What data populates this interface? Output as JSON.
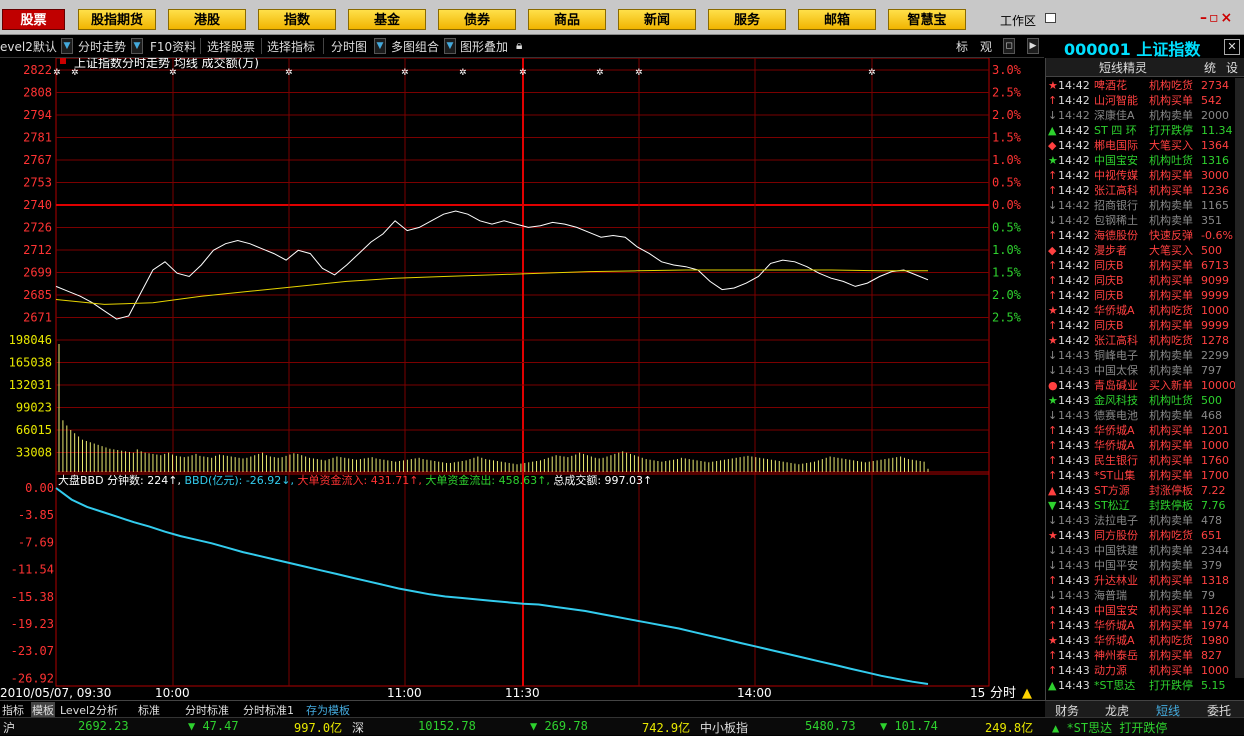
{
  "menu": [
    "股票",
    "股指期货",
    "港股",
    "指数",
    "基金",
    "债券",
    "商品",
    "新闻",
    "服务",
    "邮箱",
    "智慧宝"
  ],
  "workarea": "工作区",
  "toolbar": {
    "level2": "evel2默认",
    "items": [
      "分时走势",
      "F10资料",
      "选择股票",
      "选择指标",
      "分时图",
      "多图组合",
      "图形叠加"
    ],
    "right_icons": [
      "标",
      "观"
    ]
  },
  "index_header": {
    "code": "000001",
    "name": "上证指数"
  },
  "chart_data": [
    {
      "type": "line",
      "title": "上证指数分时走势 均线 成交额(万)",
      "y_ticks": [
        2822,
        2808,
        2794,
        2781,
        2767,
        2753,
        2740,
        2726,
        2712,
        2699,
        2685,
        2671
      ],
      "y_range": [
        2665,
        2825
      ],
      "right_ticks": [
        "3.0%",
        "2.5%",
        "2.0%",
        "1.5%",
        "1.0%",
        "0.5%",
        "0.0%",
        "0.5%",
        "1.0%",
        "1.5%",
        "2.0%",
        "2.5%"
      ],
      "x_labels": [
        "2010/05/07, 09:30",
        "10:00",
        "11:00",
        "11:30",
        "14:00",
        "15:00"
      ],
      "series": [
        {
          "name": "分时走势",
          "color": "#ffffff",
          "values": [
            2690,
            2687,
            2684,
            2680,
            2675,
            2670,
            2672,
            2686,
            2700,
            2705,
            2698,
            2696,
            2703,
            2712,
            2716,
            2718,
            2716,
            2713,
            2710,
            2706,
            2712,
            2710,
            2701,
            2697,
            2703,
            2710,
            2717,
            2722,
            2730,
            2724,
            2726,
            2730,
            2734,
            2736,
            2734,
            2730,
            2728,
            2730,
            2728,
            2726,
            2727,
            2729,
            2728,
            2726,
            2723,
            2720,
            2721,
            2720,
            2714,
            2710,
            2705,
            2703,
            2702,
            2700,
            2693,
            2688,
            2689,
            2692,
            2696,
            2704,
            2706,
            2705,
            2702,
            2698,
            2695,
            2693,
            2690,
            2692,
            2696,
            2699,
            2700,
            2697,
            2694
          ],
          "t": [
            0,
            2,
            4,
            7,
            10,
            15,
            20,
            25,
            28,
            32,
            36,
            40,
            45,
            50,
            55,
            60,
            66,
            72,
            78,
            82,
            86,
            90,
            95,
            100,
            106,
            110,
            116,
            120,
            126,
            130,
            134,
            140,
            145,
            150,
            154,
            158,
            162,
            166,
            170,
            174,
            178,
            182,
            186,
            190,
            194,
            198,
            202,
            206,
            210,
            214,
            218,
            222,
            226,
            230,
            234,
            238,
            242,
            246,
            250,
            254,
            258,
            262,
            166.1,
            170.1,
            174.1,
            178.1,
            182.1,
            186.1,
            190.1,
            194.1,
            198.1,
            202.1,
            206.1
          ]
        },
        {
          "name": "均线",
          "color": "#e6d300",
          "values": [
            2682,
            2679,
            2680,
            2684,
            2687,
            2690,
            2693,
            2695,
            2696,
            2697,
            2698,
            2699,
            2699.5,
            2700,
            2700,
            2700,
            2700,
            2699.5,
            2699.5
          ]
        }
      ]
    },
    {
      "type": "bar",
      "title": "成交额(万)",
      "y_ticks": [
        198046,
        165038,
        132031,
        99023,
        66015,
        33008
      ],
      "y_max": 198046,
      "values": [
        198000,
        80000,
        72000,
        65000,
        60000,
        55000,
        50000,
        48000,
        46000,
        44000,
        42000,
        40000,
        38000,
        36000,
        35000,
        34000,
        33000,
        32000,
        31000,
        30000,
        35000,
        32000,
        30000,
        29000,
        28000,
        27000,
        26000,
        28000,
        30000,
        27000,
        25000,
        24000,
        23000,
        24000,
        26000,
        28000,
        25000,
        24000,
        23000,
        22000,
        25000,
        27000,
        26000,
        25000,
        24000,
        23000,
        22000,
        21000,
        22000,
        24000,
        26000,
        28000,
        30000,
        26000,
        24000,
        23000,
        22000,
        23000,
        25000,
        27000,
        29000,
        28000,
        26000,
        24000,
        22000,
        21000,
        20000,
        19000,
        18000,
        20000,
        22000,
        24000,
        23000,
        22000,
        21000,
        20000,
        19000,
        20000,
        21000,
        22000,
        23000,
        21000,
        20000,
        19000,
        18000,
        17000,
        16000,
        17000,
        18000,
        19000,
        20000,
        21000,
        22000,
        20000,
        19000,
        18000,
        17000,
        16000,
        15000,
        14000,
        14000,
        15000,
        16000,
        17000,
        18000,
        20000,
        22000,
        24000,
        22000,
        20000,
        19000,
        18000,
        17000,
        16000,
        15000,
        14000,
        13000,
        12000,
        13000,
        14000,
        15000,
        16000,
        17000,
        18000,
        20000,
        22000,
        24000,
        26000,
        25000,
        24000,
        23000,
        25000,
        27000,
        30000,
        28000,
        26000,
        24000,
        22000,
        21000,
        22000,
        24000,
        26000,
        28000,
        30000,
        32000,
        30000,
        28000,
        26000,
        24000,
        22000,
        20000,
        19000,
        18000,
        17000,
        16000,
        17000,
        18000,
        19000,
        20000,
        22000,
        21000,
        20000,
        19000,
        18000,
        17000,
        16000,
        15000,
        16000,
        17000,
        18000,
        19000,
        20000,
        21000,
        22000,
        23000,
        24000,
        25000,
        24000,
        23000,
        22000,
        21000,
        20000,
        19000,
        18000,
        17000,
        16000,
        15000,
        14000,
        13000,
        12000,
        13000,
        14000,
        15000,
        16000,
        18000,
        20000,
        22000,
        24000,
        23000,
        22000,
        21000,
        20000,
        19000,
        18000,
        17000,
        16000,
        15000,
        16000,
        17000,
        18000,
        19000,
        20000,
        21000,
        22000,
        23000,
        24000,
        22000,
        20000,
        19000,
        18000,
        17000,
        16000,
        5000
      ]
    },
    {
      "type": "line",
      "title": "大盘BBD",
      "y_ticks": [
        "0.00",
        "-3.85",
        "-7.69",
        "-11.54",
        "-15.38",
        "-19.23",
        "-23.07",
        "-26.92"
      ],
      "y_range": [
        -26.92,
        0
      ],
      "series": [
        {
          "name": "BBD(亿元)",
          "color": "#33ccee",
          "values": [
            0,
            -1.6,
            -2.6,
            -3.3,
            -4.0,
            -4.7,
            -5.3,
            -6.0,
            -6.6,
            -7.1,
            -7.6,
            -8.2,
            -8.8,
            -9.3,
            -9.8,
            -10.3,
            -10.8,
            -11.3,
            -11.8,
            -12.3,
            -12.8,
            -13.3,
            -13.8,
            -14.2,
            -14.6,
            -14.9,
            -15.1,
            -15.3,
            -15.5,
            -15.7,
            -15.9,
            -16.0,
            -16.3,
            -16.6,
            -16.9,
            -17.3,
            -17.7,
            -18.1,
            -18.5,
            -18.9,
            -19.3,
            -19.8,
            -20.3,
            -20.8,
            -21.3,
            -21.8,
            -22.3,
            -22.8,
            -23.3,
            -23.8,
            -24.3,
            -24.8,
            -25.3,
            -25.8,
            -26.2,
            -26.6,
            -26.92
          ]
        }
      ]
    }
  ],
  "bbd_legend": {
    "label": "大盘BBD",
    "minutes_label": "分钟数:",
    "minutes": "224",
    "bbd_label": "BBD(亿元):",
    "bbd": "-26.92",
    "inflow_label": "大单资金流入:",
    "inflow": "431.71",
    "outflow_label": "大单资金流出:",
    "outflow": "458.63",
    "volume_label": "总成交额:",
    "volume": "997.03"
  },
  "right_panel": {
    "tab": "短线精灵",
    "side_buttons": [
      "统",
      "设"
    ],
    "rows": [
      {
        "mark": "★",
        "time": "14:42",
        "name": "啤酒花",
        "action": "机构吃货",
        "value": "2734",
        "color": "#ff4040"
      },
      {
        "mark": "↑",
        "time": "14:42",
        "name": "山河智能",
        "action": "机构买单",
        "value": "542",
        "color": "#ff4040"
      },
      {
        "mark": "↓",
        "time": "14:42",
        "name": "深康佳A",
        "action": "机构卖单",
        "value": "2000",
        "color": "#888"
      },
      {
        "mark": "▲",
        "time": "14:42",
        "name": "ST 四 环",
        "action": "打开跌停",
        "value": "11.34",
        "color": "#2ed12e"
      },
      {
        "mark": "◆",
        "time": "14:42",
        "name": "郴电国际",
        "action": "大笔买入",
        "value": "1364",
        "color": "#ff4040"
      },
      {
        "mark": "★",
        "time": "14:42",
        "name": "中国宝安",
        "action": "机构吐货",
        "value": "1316",
        "color": "#2ed12e"
      },
      {
        "mark": "↑",
        "time": "14:42",
        "name": "中视传媒",
        "action": "机构买单",
        "value": "3000",
        "color": "#ff4040"
      },
      {
        "mark": "↑",
        "time": "14:42",
        "name": "张江高科",
        "action": "机构买单",
        "value": "1236",
        "color": "#ff4040"
      },
      {
        "mark": "↓",
        "time": "14:42",
        "name": "招商银行",
        "action": "机构卖单",
        "value": "1165",
        "color": "#888"
      },
      {
        "mark": "↓",
        "time": "14:42",
        "name": "包钢稀土",
        "action": "机构卖单",
        "value": "351",
        "color": "#888"
      },
      {
        "mark": "↑",
        "time": "14:42",
        "name": "海德股份",
        "action": "快速反弹",
        "value": "-0.6%",
        "color": "#ff4040"
      },
      {
        "mark": "◆",
        "time": "14:42",
        "name": "漫步者",
        "action": "大笔买入",
        "value": "500",
        "color": "#ff4040"
      },
      {
        "mark": "↑",
        "time": "14:42",
        "name": "同庆B",
        "action": "机构买单",
        "value": "6713",
        "color": "#ff4040"
      },
      {
        "mark": "↑",
        "time": "14:42",
        "name": "同庆B",
        "action": "机构买单",
        "value": "9099",
        "color": "#ff4040"
      },
      {
        "mark": "↑",
        "time": "14:42",
        "name": "同庆B",
        "action": "机构买单",
        "value": "9999",
        "color": "#ff4040"
      },
      {
        "mark": "★",
        "time": "14:42",
        "name": "华侨城A",
        "action": "机构吃货",
        "value": "1000",
        "color": "#ff4040"
      },
      {
        "mark": "↑",
        "time": "14:42",
        "name": "同庆B",
        "action": "机构买单",
        "value": "9999",
        "color": "#ff4040"
      },
      {
        "mark": "★",
        "time": "14:42",
        "name": "张江高科",
        "action": "机构吃货",
        "value": "1278",
        "color": "#ff4040"
      },
      {
        "mark": "↓",
        "time": "14:43",
        "name": "铜峰电子",
        "action": "机构卖单",
        "value": "2299",
        "color": "#888"
      },
      {
        "mark": "↓",
        "time": "14:43",
        "name": "中国太保",
        "action": "机构卖单",
        "value": "797",
        "color": "#888"
      },
      {
        "mark": "●",
        "time": "14:43",
        "name": "青岛碱业",
        "action": "买入新单",
        "value": "10000",
        "color": "#ff4040"
      },
      {
        "mark": "★",
        "time": "14:43",
        "name": "金风科技",
        "action": "机构吐货",
        "value": "500",
        "color": "#2ed12e"
      },
      {
        "mark": "↓",
        "time": "14:43",
        "name": "德赛电池",
        "action": "机构卖单",
        "value": "468",
        "color": "#888"
      },
      {
        "mark": "↑",
        "time": "14:43",
        "name": "华侨城A",
        "action": "机构买单",
        "value": "1201",
        "color": "#ff4040"
      },
      {
        "mark": "↑",
        "time": "14:43",
        "name": "华侨城A",
        "action": "机构买单",
        "value": "1000",
        "color": "#ff4040"
      },
      {
        "mark": "↑",
        "time": "14:43",
        "name": "民生银行",
        "action": "机构买单",
        "value": "1760",
        "color": "#ff4040"
      },
      {
        "mark": "↑",
        "time": "14:43",
        "name": "*ST山集",
        "action": "机构买单",
        "value": "1700",
        "color": "#ff4040"
      },
      {
        "mark": "▲",
        "time": "14:43",
        "name": "ST方源",
        "action": "封涨停板",
        "value": "7.22",
        "color": "#ff4040"
      },
      {
        "mark": "▼",
        "time": "14:43",
        "name": "ST松辽",
        "action": "封跌停板",
        "value": "7.76",
        "color": "#2ed12e"
      },
      {
        "mark": "↓",
        "time": "14:43",
        "name": "法拉电子",
        "action": "机构卖单",
        "value": "478",
        "color": "#888"
      },
      {
        "mark": "★",
        "time": "14:43",
        "name": "同方股份",
        "action": "机构吃货",
        "value": "651",
        "color": "#ff4040"
      },
      {
        "mark": "↓",
        "time": "14:43",
        "name": "中国铁建",
        "action": "机构卖单",
        "value": "2344",
        "color": "#888"
      },
      {
        "mark": "↓",
        "time": "14:43",
        "name": "中国平安",
        "action": "机构卖单",
        "value": "379",
        "color": "#888"
      },
      {
        "mark": "↑",
        "time": "14:43",
        "name": "升达林业",
        "action": "机构买单",
        "value": "1318",
        "color": "#ff4040"
      },
      {
        "mark": "↓",
        "time": "14:43",
        "name": "海普瑞",
        "action": "机构卖单",
        "value": "79",
        "color": "#888"
      },
      {
        "mark": "↑",
        "time": "14:43",
        "name": "中国宝安",
        "action": "机构买单",
        "value": "1126",
        "color": "#ff4040"
      },
      {
        "mark": "↑",
        "time": "14:43",
        "name": "华侨城A",
        "action": "机构买单",
        "value": "1974",
        "color": "#ff4040"
      },
      {
        "mark": "★",
        "time": "14:43",
        "name": "华侨城A",
        "action": "机构吃货",
        "value": "1980",
        "color": "#ff4040"
      },
      {
        "mark": "↑",
        "time": "14:43",
        "name": "神州泰岳",
        "action": "机构买单",
        "value": "827",
        "color": "#ff4040"
      },
      {
        "mark": "↑",
        "time": "14:43",
        "name": "动力源",
        "action": "机构买单",
        "value": "1000",
        "color": "#ff4040"
      },
      {
        "mark": "▲",
        "time": "14:43",
        "name": "*ST思达",
        "action": "打开跌停",
        "value": "5.15",
        "color": "#2ed12e"
      }
    ],
    "bottom_tabs": [
      "财务",
      "龙虎",
      "短线",
      "委托"
    ]
  },
  "bottom_tabs": [
    "指标",
    "模板",
    "Level2分析",
    "标准",
    "分时标准",
    "分时标准1",
    "存为模板"
  ],
  "status": {
    "sh_label": "沪",
    "sh_index": "2692.23",
    "sh_change": "▼ 47.47",
    "sh_amount": "997.0亿",
    "sz_label": "深",
    "sz_index": "10152.78",
    "sz_change": "▼ 269.78",
    "sz_amount": "742.9亿",
    "zx_label": "中小板指",
    "zx_index": "5480.73",
    "zx_change": "▼ 101.74",
    "zx_amount": "249.8亿",
    "ticker": "▲ *ST思达 打开跌停"
  },
  "minute_label": "分时"
}
